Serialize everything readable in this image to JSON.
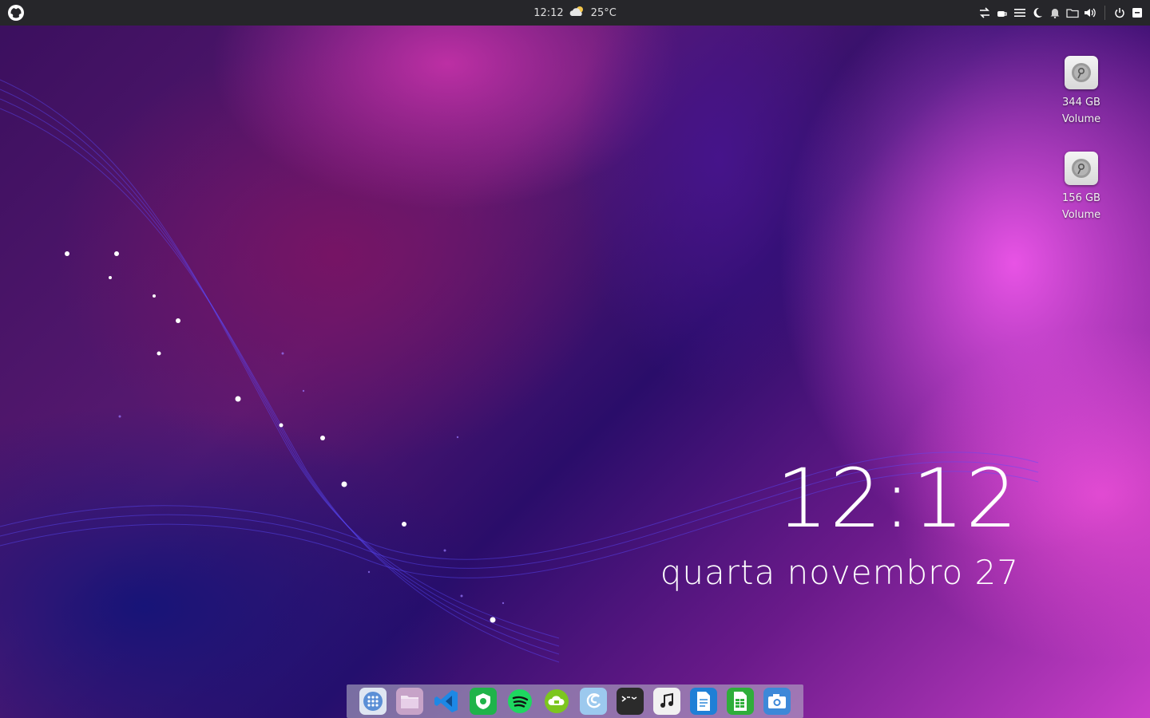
{
  "topbar": {
    "time": "12:12",
    "weather_temp": "25°C",
    "weather_icon": "partly-cloudy-icon",
    "tray_icons": [
      "network-arrows-icon",
      "coffee-icon",
      "menu-lines-icon",
      "night-mode-icon",
      "notification-bell-icon",
      "folder-icon",
      "volume-icon",
      "power-icon",
      "keyboard-layout-icon"
    ]
  },
  "desktop": {
    "icons": [
      {
        "size": "344 GB",
        "label": "Volume"
      },
      {
        "size": "156 GB",
        "label": "Volume"
      }
    ]
  },
  "clock_widget": {
    "time": "12:12",
    "date": "quarta novembro 27"
  },
  "dock": {
    "apps": [
      {
        "name": "app-grid",
        "color": "#dfe6f2"
      },
      {
        "name": "files",
        "color": "#c7a3c8"
      },
      {
        "name": "vscode",
        "color": "#1e88e5"
      },
      {
        "name": "browser",
        "color": "#1fb34a"
      },
      {
        "name": "spotify",
        "color": "#1ed760"
      },
      {
        "name": "android-cloud",
        "color": "#7cc61f"
      },
      {
        "name": "edge-like",
        "color": "#9cc9ee"
      },
      {
        "name": "terminal",
        "color": "#2b2b2b"
      },
      {
        "name": "music",
        "color": "#f1f1f1"
      },
      {
        "name": "writer",
        "color": "#1f7fd6"
      },
      {
        "name": "calc",
        "color": "#2fae3a"
      },
      {
        "name": "screenshot",
        "color": "#3d88d8"
      }
    ]
  }
}
